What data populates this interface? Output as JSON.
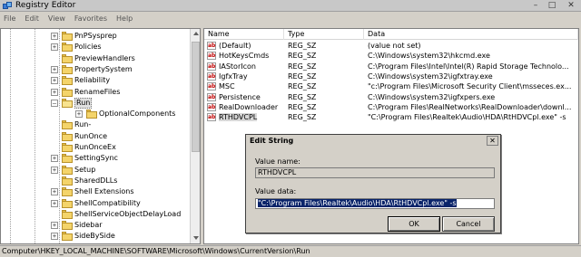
{
  "window": {
    "title": "Registry Editor",
    "controls": {
      "minimize": "–",
      "maximize": "□",
      "close": "✕"
    }
  },
  "menu": [
    "File",
    "Edit",
    "View",
    "Favorites",
    "Help"
  ],
  "tree": {
    "items": [
      {
        "label": "PnPSysprep",
        "expander": "+",
        "open": false
      },
      {
        "label": "Policies",
        "expander": "+",
        "open": false
      },
      {
        "label": "PreviewHandlers",
        "expander": "",
        "open": false
      },
      {
        "label": "PropertySystem",
        "expander": "+",
        "open": false
      },
      {
        "label": "Reliability",
        "expander": "+",
        "open": false
      },
      {
        "label": "RenameFiles",
        "expander": "+",
        "open": false
      },
      {
        "label": "Run",
        "expander": "–",
        "open": true,
        "selected": true
      },
      {
        "label": "OptionalComponents",
        "expander": "+",
        "open": false,
        "child": true
      },
      {
        "label": "Run-",
        "expander": "",
        "open": false
      },
      {
        "label": "RunOnce",
        "expander": "",
        "open": false
      },
      {
        "label": "RunOnceEx",
        "expander": "",
        "open": false
      },
      {
        "label": "SettingSync",
        "expander": "+",
        "open": false
      },
      {
        "label": "Setup",
        "expander": "+",
        "open": false
      },
      {
        "label": "SharedDLLs",
        "expander": "",
        "open": false
      },
      {
        "label": "Shell Extensions",
        "expander": "+",
        "open": false
      },
      {
        "label": "ShellCompatibility",
        "expander": "+",
        "open": false
      },
      {
        "label": "ShellServiceObjectDelayLoad",
        "expander": "",
        "open": false
      },
      {
        "label": "Sidebar",
        "expander": "+",
        "open": false
      },
      {
        "label": "SideBySide",
        "expander": "+",
        "open": false
      }
    ]
  },
  "list": {
    "columns": [
      "Name",
      "Type",
      "Data"
    ],
    "rows": [
      {
        "name": "(Default)",
        "type": "REG_SZ",
        "data": "(value not set)"
      },
      {
        "name": "HotKeysCmds",
        "type": "REG_SZ",
        "data": "C:\\Windows\\system32\\hkcmd.exe"
      },
      {
        "name": "IAStorIcon",
        "type": "REG_SZ",
        "data": "C:\\Program Files\\Intel\\Intel(R) Rapid Storage Technolo..."
      },
      {
        "name": "IgfxTray",
        "type": "REG_SZ",
        "data": "C:\\Windows\\system32\\igfxtray.exe"
      },
      {
        "name": "MSC",
        "type": "REG_SZ",
        "data": "\"c:\\Program Files\\Microsoft Security Client\\msseces.ex..."
      },
      {
        "name": "Persistence",
        "type": "REG_SZ",
        "data": "C:\\Windows\\system32\\igfxpers.exe"
      },
      {
        "name": "RealDownloader",
        "type": "REG_SZ",
        "data": "C:\\Program Files\\RealNetworks\\RealDownloader\\downl..."
      },
      {
        "name": "RTHDVCPL",
        "type": "REG_SZ",
        "data": "\"C:\\Program Files\\Realtek\\Audio\\HDA\\RtHDVCpl.exe\" -s",
        "selected": true
      }
    ],
    "icon_glyph": "ab"
  },
  "status_path": "Computer\\HKEY_LOCAL_MACHINE\\SOFTWARE\\Microsoft\\Windows\\CurrentVersion\\Run",
  "dialog": {
    "title": "Edit String",
    "close_glyph": "✕",
    "value_name_label": "Value name:",
    "value_name": "RTHDVCPL",
    "value_data_label": "Value data:",
    "value_data": "\"C:\\Program Files\\Realtek\\Audio\\HDA\\RtHDVCpl.exe\" -s",
    "ok_label": "OK",
    "cancel_label": "Cancel"
  },
  "colors": {
    "selection": "#0a246a",
    "value_icon": "#c00000",
    "folder": "#f4d46a"
  }
}
